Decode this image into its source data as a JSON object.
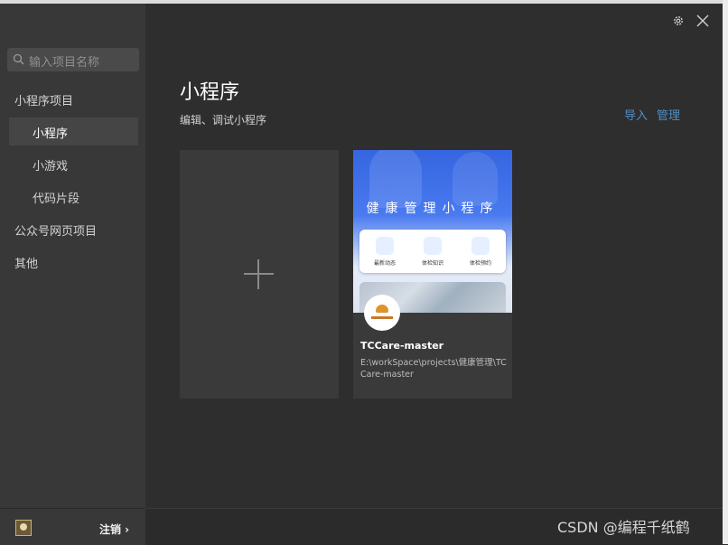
{
  "sidebar": {
    "search_placeholder": "输入项目名称",
    "groups": [
      {
        "label": "小程序项目"
      },
      {
        "label": "小程序"
      },
      {
        "label": "小游戏"
      },
      {
        "label": "代码片段"
      },
      {
        "label": "公众号网页项目"
      },
      {
        "label": "其他"
      }
    ],
    "footer": {
      "logout_label": "注销 ›"
    }
  },
  "header": {
    "settings_icon": "gear-icon",
    "close_icon": "close-icon"
  },
  "main": {
    "title": "小程序",
    "subtitle": "编辑、调试小程序",
    "actions": {
      "import_label": "导入",
      "manage_label": "管理"
    },
    "new_project_icon": "plus-icon",
    "projects": [
      {
        "banner_title": "健康管理小程序",
        "features": [
          "最新动态",
          "体检知识",
          "体检预约"
        ],
        "name": "TCCare-master",
        "path": "E:\\workSpace\\projects\\健康管理\\TCCare-master"
      }
    ]
  },
  "watermark": "CSDN @编程千纸鹤",
  "colors": {
    "accent": "#4f8fc6",
    "background": "#2e2e2e",
    "sidebar": "#383838"
  }
}
